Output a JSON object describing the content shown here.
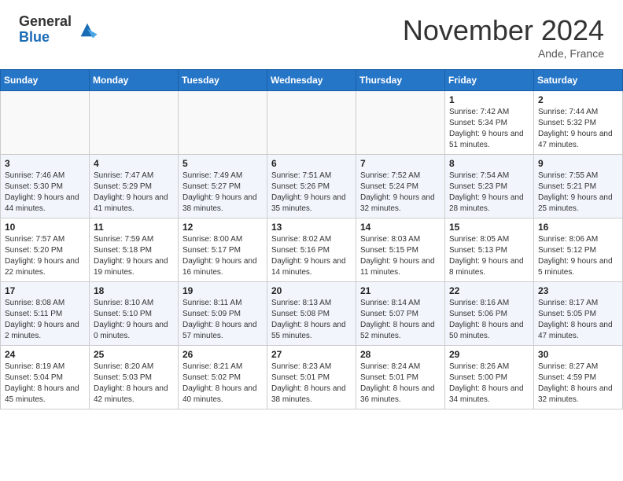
{
  "header": {
    "logo_general": "General",
    "logo_blue": "Blue",
    "month_title": "November 2024",
    "location": "Ande, France"
  },
  "days_of_week": [
    "Sunday",
    "Monday",
    "Tuesday",
    "Wednesday",
    "Thursday",
    "Friday",
    "Saturday"
  ],
  "weeks": [
    [
      {
        "day": "",
        "info": ""
      },
      {
        "day": "",
        "info": ""
      },
      {
        "day": "",
        "info": ""
      },
      {
        "day": "",
        "info": ""
      },
      {
        "day": "",
        "info": ""
      },
      {
        "day": "1",
        "info": "Sunrise: 7:42 AM\nSunset: 5:34 PM\nDaylight: 9 hours and 51 minutes."
      },
      {
        "day": "2",
        "info": "Sunrise: 7:44 AM\nSunset: 5:32 PM\nDaylight: 9 hours and 47 minutes."
      }
    ],
    [
      {
        "day": "3",
        "info": "Sunrise: 7:46 AM\nSunset: 5:30 PM\nDaylight: 9 hours and 44 minutes."
      },
      {
        "day": "4",
        "info": "Sunrise: 7:47 AM\nSunset: 5:29 PM\nDaylight: 9 hours and 41 minutes."
      },
      {
        "day": "5",
        "info": "Sunrise: 7:49 AM\nSunset: 5:27 PM\nDaylight: 9 hours and 38 minutes."
      },
      {
        "day": "6",
        "info": "Sunrise: 7:51 AM\nSunset: 5:26 PM\nDaylight: 9 hours and 35 minutes."
      },
      {
        "day": "7",
        "info": "Sunrise: 7:52 AM\nSunset: 5:24 PM\nDaylight: 9 hours and 32 minutes."
      },
      {
        "day": "8",
        "info": "Sunrise: 7:54 AM\nSunset: 5:23 PM\nDaylight: 9 hours and 28 minutes."
      },
      {
        "day": "9",
        "info": "Sunrise: 7:55 AM\nSunset: 5:21 PM\nDaylight: 9 hours and 25 minutes."
      }
    ],
    [
      {
        "day": "10",
        "info": "Sunrise: 7:57 AM\nSunset: 5:20 PM\nDaylight: 9 hours and 22 minutes."
      },
      {
        "day": "11",
        "info": "Sunrise: 7:59 AM\nSunset: 5:18 PM\nDaylight: 9 hours and 19 minutes."
      },
      {
        "day": "12",
        "info": "Sunrise: 8:00 AM\nSunset: 5:17 PM\nDaylight: 9 hours and 16 minutes."
      },
      {
        "day": "13",
        "info": "Sunrise: 8:02 AM\nSunset: 5:16 PM\nDaylight: 9 hours and 14 minutes."
      },
      {
        "day": "14",
        "info": "Sunrise: 8:03 AM\nSunset: 5:15 PM\nDaylight: 9 hours and 11 minutes."
      },
      {
        "day": "15",
        "info": "Sunrise: 8:05 AM\nSunset: 5:13 PM\nDaylight: 9 hours and 8 minutes."
      },
      {
        "day": "16",
        "info": "Sunrise: 8:06 AM\nSunset: 5:12 PM\nDaylight: 9 hours and 5 minutes."
      }
    ],
    [
      {
        "day": "17",
        "info": "Sunrise: 8:08 AM\nSunset: 5:11 PM\nDaylight: 9 hours and 2 minutes."
      },
      {
        "day": "18",
        "info": "Sunrise: 8:10 AM\nSunset: 5:10 PM\nDaylight: 9 hours and 0 minutes."
      },
      {
        "day": "19",
        "info": "Sunrise: 8:11 AM\nSunset: 5:09 PM\nDaylight: 8 hours and 57 minutes."
      },
      {
        "day": "20",
        "info": "Sunrise: 8:13 AM\nSunset: 5:08 PM\nDaylight: 8 hours and 55 minutes."
      },
      {
        "day": "21",
        "info": "Sunrise: 8:14 AM\nSunset: 5:07 PM\nDaylight: 8 hours and 52 minutes."
      },
      {
        "day": "22",
        "info": "Sunrise: 8:16 AM\nSunset: 5:06 PM\nDaylight: 8 hours and 50 minutes."
      },
      {
        "day": "23",
        "info": "Sunrise: 8:17 AM\nSunset: 5:05 PM\nDaylight: 8 hours and 47 minutes."
      }
    ],
    [
      {
        "day": "24",
        "info": "Sunrise: 8:19 AM\nSunset: 5:04 PM\nDaylight: 8 hours and 45 minutes."
      },
      {
        "day": "25",
        "info": "Sunrise: 8:20 AM\nSunset: 5:03 PM\nDaylight: 8 hours and 42 minutes."
      },
      {
        "day": "26",
        "info": "Sunrise: 8:21 AM\nSunset: 5:02 PM\nDaylight: 8 hours and 40 minutes."
      },
      {
        "day": "27",
        "info": "Sunrise: 8:23 AM\nSunset: 5:01 PM\nDaylight: 8 hours and 38 minutes."
      },
      {
        "day": "28",
        "info": "Sunrise: 8:24 AM\nSunset: 5:01 PM\nDaylight: 8 hours and 36 minutes."
      },
      {
        "day": "29",
        "info": "Sunrise: 8:26 AM\nSunset: 5:00 PM\nDaylight: 8 hours and 34 minutes."
      },
      {
        "day": "30",
        "info": "Sunrise: 8:27 AM\nSunset: 4:59 PM\nDaylight: 8 hours and 32 minutes."
      }
    ]
  ]
}
